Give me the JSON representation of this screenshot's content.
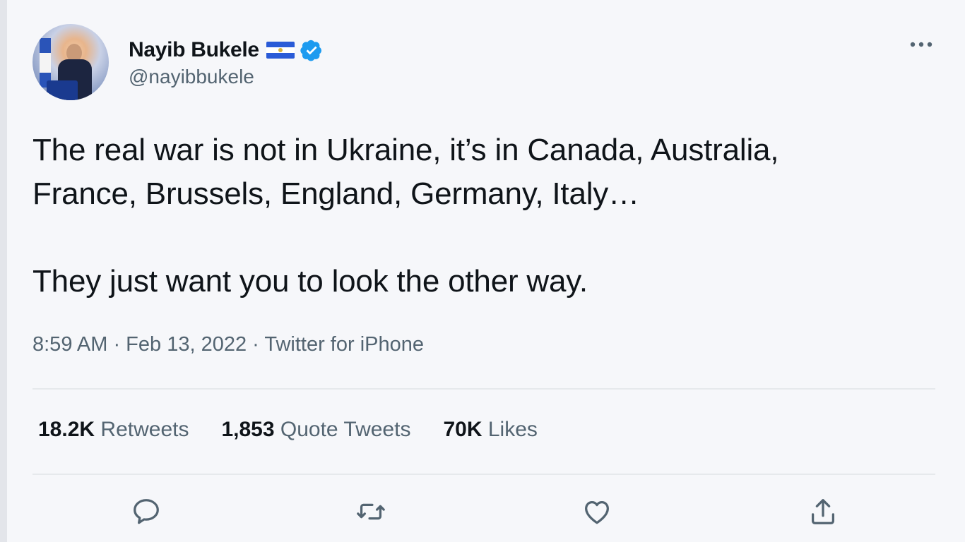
{
  "author": {
    "display_name": "Nayib Bukele",
    "handle": "@nayibbukele",
    "flag_icon": "el-salvador-flag-icon",
    "verified_icon": "verified-badge-icon"
  },
  "tweet": {
    "text": "The real war is not in Ukraine, it’s in Canada, Australia,\nFrance, Brussels, England, Germany, Italy…\n\nThey just want you to look the other way.",
    "meta": "8:59 AM · Feb 13, 2022 · Twitter for iPhone"
  },
  "stats": {
    "retweets_count": "18.2K",
    "retweets_label": "Retweets",
    "quotes_count": "1,853",
    "quotes_label": "Quote Tweets",
    "likes_count": "70K",
    "likes_label": "Likes"
  },
  "actions": [
    "reply-icon",
    "retweet-icon",
    "like-icon",
    "share-icon"
  ],
  "colors": {
    "text": "#0f1419",
    "secondary": "#536471",
    "verified": "#1d9bf0",
    "background": "#f6f7fa"
  }
}
